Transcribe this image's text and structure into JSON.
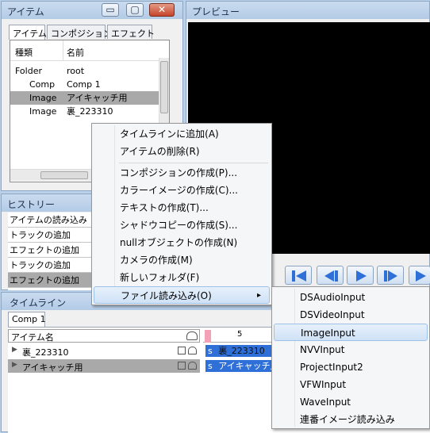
{
  "items_panel": {
    "title": "アイテム",
    "tabs": [
      "アイテム",
      "コンポジション",
      "エフェクト"
    ],
    "columns": [
      "種類",
      "名前"
    ],
    "rows": [
      {
        "type": "Folder",
        "name": "root",
        "selected": false
      },
      {
        "type": "Comp",
        "name": "Comp 1",
        "selected": false
      },
      {
        "type": "Image",
        "name": "アイキャッチ用",
        "selected": true
      },
      {
        "type": "Image",
        "name": "裏_223310",
        "selected": false
      }
    ]
  },
  "preview_panel": {
    "title": "プレビュー"
  },
  "history_panel": {
    "title": "ヒストリー",
    "items": [
      "アイテムの読み込み",
      "トラックの追加",
      "エフェクトの追加",
      "トラックの追加",
      "エフェクトの追加"
    ]
  },
  "timeline_panel": {
    "title": "タイムライン",
    "tab": "Comp 1",
    "header_label": "アイテム名",
    "ruler_mark": "5",
    "tracks": [
      {
        "name": "裏_223310",
        "clip": "裏_223310",
        "selected": false
      },
      {
        "name": "アイキャッチ用",
        "clip": "アイキャッチ用",
        "selected": true
      }
    ],
    "clip_marker": "s"
  },
  "context_menu": {
    "items": [
      "タイムラインに追加(A)",
      "アイテムの削除(R)",
      "コンポジションの作成(P)...",
      "カラーイメージの作成(C)...",
      "テキストの作成(T)...",
      "シャドウコピーの作成(S)...",
      "nullオブジェクトの作成(N)",
      "カメラの作成(M)",
      "新しいフォルダ(F)",
      "ファイル読み込み(O)"
    ],
    "highlighted": "ファイル読み込み(O)",
    "submenu_arrow": "▸"
  },
  "submenu": {
    "items": [
      "DSAudioInput",
      "DSVideoInput",
      "ImageInput",
      "NVVInput",
      "ProjectInput2",
      "VFWInput",
      "WaveInput",
      "連番イメージ読み込み"
    ],
    "highlighted": "ImageInput"
  },
  "window_controls": {
    "minimize": "▭",
    "maximize": "▢",
    "close": "✕"
  },
  "colors": {
    "accent": "#2e6fd8",
    "selection": "#a9a9a9",
    "menu_highlight": "#cfe2f6"
  }
}
